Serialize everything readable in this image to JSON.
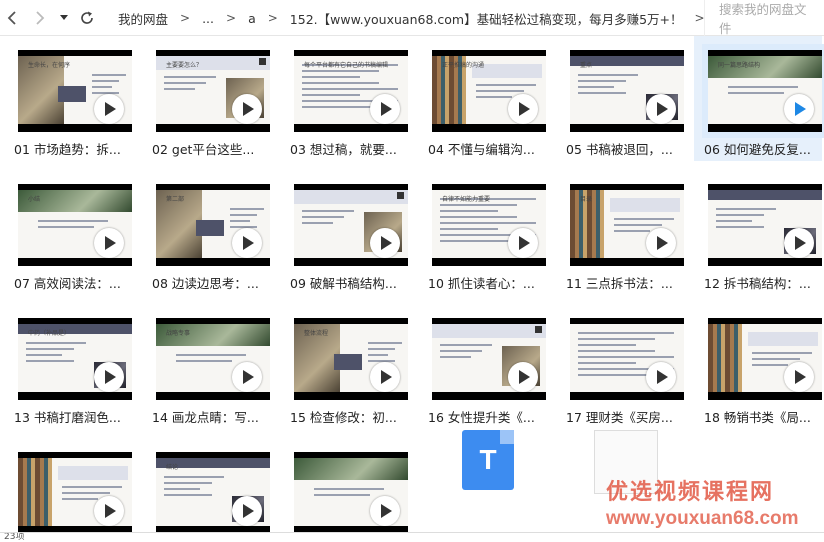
{
  "nav": {
    "back_icon": "chevron-left-icon",
    "forward_icon": "chevron-right-icon",
    "dropdown_icon": "caret-down-icon",
    "refresh_icon": "refresh-icon"
  },
  "breadcrumb": {
    "items": [
      "我的网盘",
      "...",
      "a",
      "152.【www.youxuan68.com】基础轻松过稿变现，每月多赚5万+！"
    ],
    "separator": ">",
    "trailing": ">"
  },
  "search": {
    "placeholder": "搜索我的网盘文件"
  },
  "files": [
    {
      "name": "01 市场趋势：拆...",
      "slide_text": "生命长，在何序"
    },
    {
      "name": "02 get平台这些...",
      "slide_text": "主要要怎么？"
    },
    {
      "name": "03 想过稿，就要...",
      "slide_text": "每个平台都有它自己的书稿编辑"
    },
    {
      "name": "04 不懂与编辑沟...",
      "slide_text": "正平推稿的沟通"
    },
    {
      "name": "05 书稿被退回，...",
      "slide_text": "重点"
    },
    {
      "name": "06 如何避免反复...",
      "slide_text": "同一篇思路结构"
    },
    {
      "name": "07 高效阅读法：...",
      "slide_text": "小结"
    },
    {
      "name": "08 边读边思考：...",
      "slide_text": "第二部"
    },
    {
      "name": "09 破解书稿结构...",
      "slide_text": ""
    },
    {
      "name": "10 抓住读者心：...",
      "slide_text": "自律不如能力重要"
    },
    {
      "name": "11 三点拆书法：...",
      "slide_text": "目录"
    },
    {
      "name": "12 拆书稿结构：...",
      "slide_text": ""
    },
    {
      "name": "13 书稿打磨润色...",
      "slide_text": "中药（补品是）"
    },
    {
      "name": "14 画龙点睛：写...",
      "slide_text": "战略专事"
    },
    {
      "name": "15 检查修改：初...",
      "slide_text": "整体流程"
    },
    {
      "name": "16 女性提升类《...",
      "slide_text": ""
    },
    {
      "name": "17 理财类《买房...",
      "slide_text": ""
    },
    {
      "name": "18 畅销书类《局...",
      "slide_text": ""
    },
    {
      "name": "",
      "slide_text": ""
    },
    {
      "name": "",
      "slide_text": "结论"
    },
    {
      "name": "",
      "slide_text": ""
    }
  ],
  "doc_icon_letter": "T",
  "watermark": {
    "line1": "优选视频课程网",
    "line2": "www.youxuan68.com"
  },
  "status": {
    "count_text": "23项"
  },
  "colors": {
    "selected_bg": "#e6f0fb",
    "doc_blue": "#3d8cf0",
    "watermark_red": "#e0503a"
  }
}
